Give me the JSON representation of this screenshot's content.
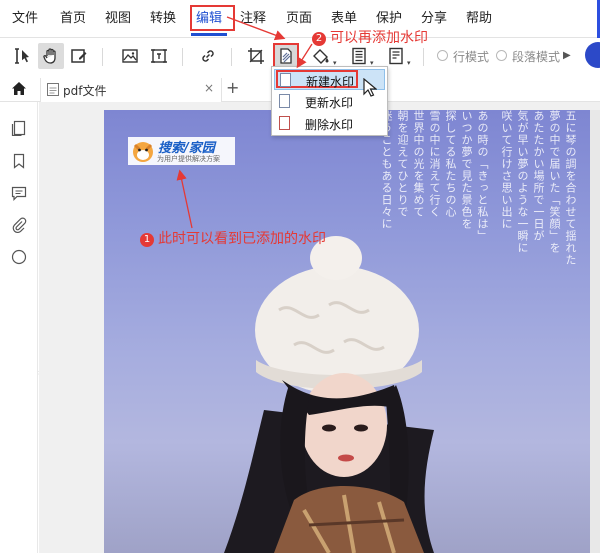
{
  "menubar": {
    "items": [
      "文件",
      "首页",
      "视图",
      "转换",
      "编辑",
      "注释",
      "页面",
      "表单",
      "保护",
      "分享",
      "帮助"
    ],
    "active": "编辑"
  },
  "toolbar": {
    "line_mode": "行模式",
    "paragraph_mode": "段落模式"
  },
  "tab": {
    "label": "pdf文件",
    "close": "×",
    "add": "+"
  },
  "watermark_menu": {
    "items": [
      "新建水印",
      "更新水印",
      "删除水印"
    ],
    "highlighted": "新建水印"
  },
  "watermark_logo": {
    "brand": "搜索/家园",
    "slogan": "为用户提供解决方案"
  },
  "annotations": {
    "step1_number": "1",
    "step1_text": "此时可以看到已添加的水印",
    "step2_number": "2",
    "step2_text": "可以再添加水印"
  },
  "page_text": {
    "columns": [
      "五に琴の調を合わせて揺れた",
      "夢の中で届いた「笑顔」を",
      "あたたかい場所で一日が",
      "気が早い夢のような一瞬に",
      "咲いて行けさ思い出に",
      "あの時の「きっと私は」",
      "いつか夢で見た景色を",
      "探してる私たちの心",
      "雪の中に消えて行く",
      "世界中の光を集めて",
      "朝を迎えてひとりで",
      "迷うこともある日々に"
    ]
  },
  "colors": {
    "accent_blue": "#1f4fd1",
    "annotation_red": "#e53935",
    "hover_blue": "#cce3f7"
  }
}
